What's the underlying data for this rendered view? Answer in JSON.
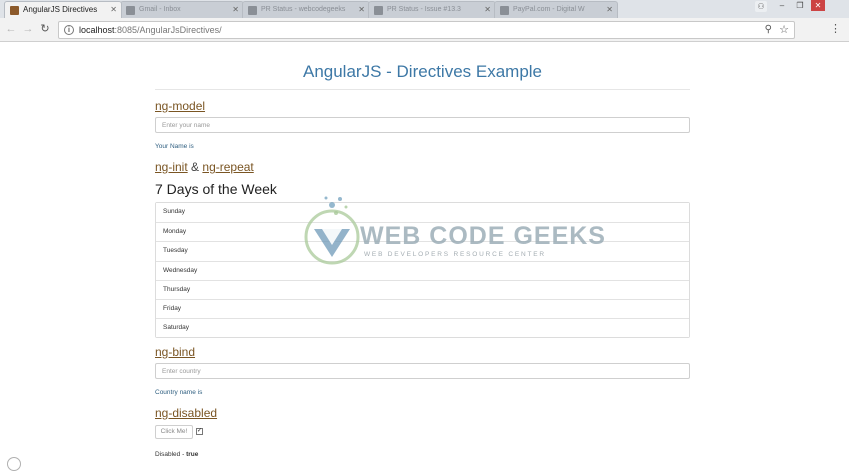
{
  "browser": {
    "tabs": [
      {
        "label": "AngularJS Directives",
        "active": true
      },
      {
        "label": "Gmail - Inbox",
        "active": false
      },
      {
        "label": "PR Status - webcodegeeks",
        "active": false
      },
      {
        "label": "PR Status - Issue #13.3",
        "active": false
      },
      {
        "label": "PayPal.com - Digital W",
        "active": false
      }
    ],
    "url_host": "localhost",
    "url_rest": ":8085/AngularJsDirectives/",
    "icons": {
      "back": "arrow-left-icon",
      "forward": "arrow-right-icon",
      "reload": "reload-icon",
      "info": "info-icon",
      "zoom": "zoom-icon",
      "bookmark": "star-icon",
      "menu": "kebab-menu-icon"
    }
  },
  "page": {
    "title": "AngularJS - Directives Example",
    "ng_model": {
      "heading": "ng-model",
      "placeholder": "Enter your name",
      "output_label": "Your Name is"
    },
    "ng_init_repeat": {
      "heading_a": "ng-init",
      "amp": "&",
      "heading_b": "ng-repeat",
      "subheading": "7 Days of the Week",
      "days": [
        "Sunday",
        "Monday",
        "Tuesday",
        "Wednesday",
        "Thursday",
        "Friday",
        "Saturday"
      ]
    },
    "ng_bind": {
      "heading": "ng-bind",
      "placeholder": "Enter country",
      "output_label": "Country name is"
    },
    "ng_disabled": {
      "heading": "ng-disabled",
      "button_label": "Click Me!",
      "checkbox_checked": true,
      "status_label": "Disabled - ",
      "status_value": "true"
    }
  },
  "watermark": {
    "name": "WEB CODE GEEKS",
    "tagline": "WEB DEVELOPERS RESOURCE CENTER"
  },
  "colors": {
    "title_blue": "#3d78a6",
    "link_brown": "#7a5523",
    "label_blue": "#2f5f80"
  }
}
